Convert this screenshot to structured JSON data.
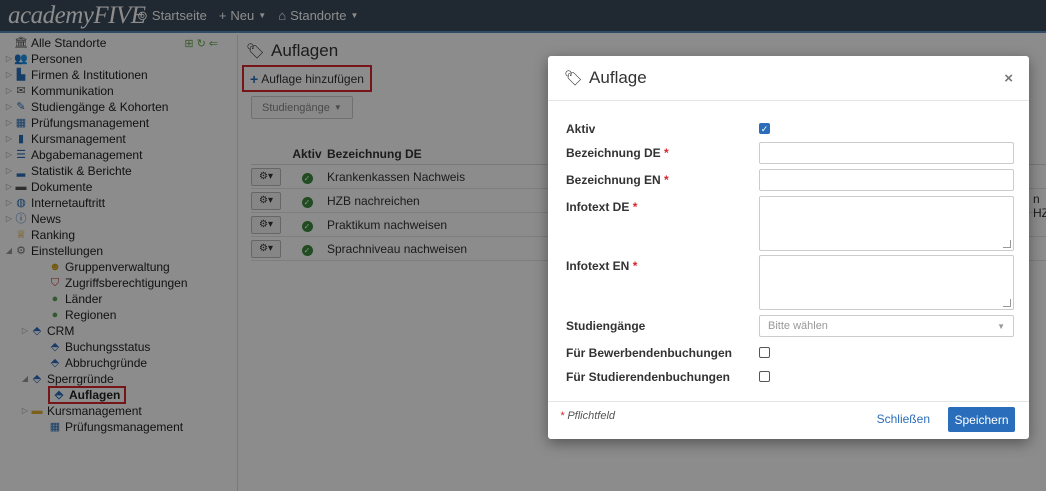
{
  "app": {
    "logo": "academyFIVE"
  },
  "topnav": [
    {
      "icon": "dashboard-icon",
      "label": "Startseite",
      "caret": false
    },
    {
      "icon": "plus-icon",
      "label": "Neu",
      "caret": true
    },
    {
      "icon": "home-icon",
      "label": "Standorte",
      "caret": true
    }
  ],
  "sidebar": {
    "items": [
      {
        "label": "Alle Standorte",
        "icon": "building-icon",
        "level": 1,
        "tw": ""
      },
      {
        "label": "Personen",
        "icon": "people-icon",
        "level": 1,
        "tw": "▷"
      },
      {
        "label": "Firmen & Institutionen",
        "icon": "factory-icon",
        "level": 1,
        "tw": "▷"
      },
      {
        "label": "Kommunikation",
        "icon": "envelope-icon",
        "level": 1,
        "tw": "▷"
      },
      {
        "label": "Studiengänge & Kohorten",
        "icon": "pen-icon",
        "level": 1,
        "tw": "▷"
      },
      {
        "label": "Prüfungsmanagement",
        "icon": "calendar-icon",
        "level": 1,
        "tw": "▷"
      },
      {
        "label": "Kursmanagement",
        "icon": "book-icon",
        "level": 1,
        "tw": "▷"
      },
      {
        "label": "Abgabemanagement",
        "icon": "list-icon",
        "level": 1,
        "tw": "▷"
      },
      {
        "label": "Statistik & Berichte",
        "icon": "chart-icon",
        "level": 1,
        "tw": "▷"
      },
      {
        "label": "Dokumente",
        "icon": "folder-icon",
        "level": 1,
        "tw": "▷"
      },
      {
        "label": "Internetauftritt",
        "icon": "globe-icon",
        "level": 1,
        "tw": "▷"
      },
      {
        "label": "News",
        "icon": "info-icon",
        "level": 1,
        "tw": "▷"
      },
      {
        "label": "Ranking",
        "icon": "trophy-icon",
        "level": 1,
        "tw": ""
      },
      {
        "label": "Einstellungen",
        "icon": "gears-icon",
        "level": 1,
        "tw": "◢"
      },
      {
        "label": "Gruppenverwaltung",
        "icon": "user-icon",
        "level": 3,
        "tw": ""
      },
      {
        "label": "Zugriffsberechtigungen",
        "icon": "shield-icon",
        "level": 3,
        "tw": ""
      },
      {
        "label": "Länder",
        "icon": "globe-green-icon",
        "level": 3,
        "tw": ""
      },
      {
        "label": "Regionen",
        "icon": "globe-green-icon",
        "level": 3,
        "tw": ""
      },
      {
        "label": "CRM",
        "icon": "tag-icon",
        "level": 2,
        "tw": "▷"
      },
      {
        "label": "Buchungsstatus",
        "icon": "tag-icon",
        "level": 3,
        "tw": ""
      },
      {
        "label": "Abbruchgründe",
        "icon": "tag-icon",
        "level": 3,
        "tw": ""
      },
      {
        "label": "Sperrgründe",
        "icon": "tag-icon",
        "level": 2,
        "tw": "◢"
      },
      {
        "label": "Auflagen",
        "icon": "tag-icon",
        "level": 4,
        "tw": "",
        "active": true
      },
      {
        "label": "Kursmanagement",
        "icon": "folder-yellow-icon",
        "level": 2,
        "tw": "▷"
      },
      {
        "label": "Prüfungsmanagement",
        "icon": "calendar-icon",
        "level": 3,
        "tw": ""
      }
    ]
  },
  "main": {
    "title": "Auflagen",
    "add_label": "Auflage hinzufügen",
    "filter_label": "Studiengänge",
    "table": {
      "headers": [
        "Aktiv",
        "Bezeichnung DE"
      ],
      "rows": [
        "Krankenkassen Nachweis",
        "HZB nachreichen",
        "Praktikum nachweisen",
        "Sprachniveau nachweisen"
      ]
    },
    "clipped_text": "n HZ"
  },
  "modal": {
    "title": "Auflage",
    "fields": {
      "aktiv": "Aktiv",
      "bez_de": "Bezeichnung DE",
      "bez_en": "Bezeichnung EN",
      "info_de": "Infotext DE",
      "info_en": "Infotext EN",
      "studiengaenge": "Studiengänge",
      "studiengaenge_placeholder": "Bitte wählen",
      "bewerber": "Für Bewerbendenbuchungen",
      "studierende": "Für Studierendenbuchungen",
      "req_mark": "*"
    },
    "footer": {
      "required_note": "* Pflichtfeld",
      "close": "Schließen",
      "save": "Speichern"
    }
  },
  "colors": {
    "topbar": "#3b4a5a",
    "accent": "#2a6ebb",
    "highlight": "#d9262c",
    "success": "#3c8a3c"
  }
}
